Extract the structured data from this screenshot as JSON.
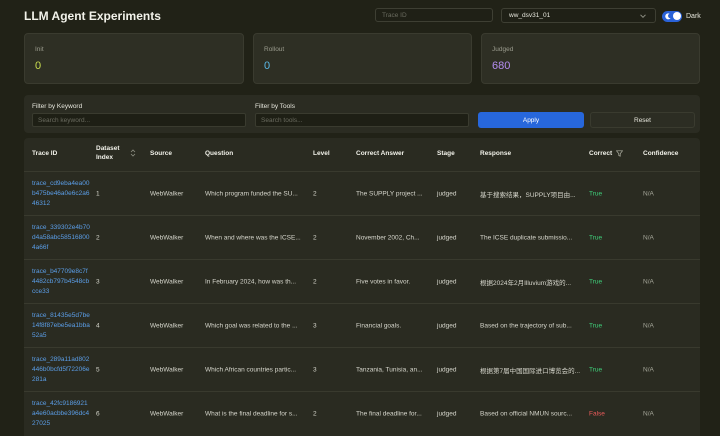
{
  "header": {
    "title": "LLM Agent Experiments",
    "trace_placeholder": "Trace ID",
    "dataset": "ww_dsv31_01",
    "theme_label": "Dark"
  },
  "stats": [
    {
      "label": "Init",
      "value": "0",
      "color": "#c9dd4f"
    },
    {
      "label": "Rollout",
      "value": "0",
      "color": "#5ab8e6"
    },
    {
      "label": "Judged",
      "value": "680",
      "color": "#b48cf0"
    }
  ],
  "filters": {
    "keyword_label": "Filter by Keyword",
    "keyword_placeholder": "Search keyword...",
    "tools_label": "Filter by Tools",
    "tools_placeholder": "Search tools...",
    "apply_label": "Apply",
    "reset_label": "Reset"
  },
  "table": {
    "headers": {
      "trace_id": "Trace ID",
      "dataset_index": "Dataset Index",
      "source": "Source",
      "question": "Question",
      "level": "Level",
      "correct_answer": "Correct Answer",
      "stage": "Stage",
      "response": "Response",
      "correct": "Correct",
      "confidence": "Confidence"
    },
    "rows": [
      {
        "trace": "trace_cd9eba4ea00b475be46a0e6c2a646312",
        "index": "1",
        "source": "WebWalker",
        "question": "Which program funded the SU...",
        "level": "2",
        "answer": "The SUPPLY project ...",
        "stage": "judged",
        "response": "基于搜索结果，SUPPLY项目由...",
        "correct": "True",
        "confidence": "N/A"
      },
      {
        "trace": "trace_339302e4b70d4a58abc585168004a66f",
        "index": "2",
        "source": "WebWalker",
        "question": "When and where was the ICSE...",
        "level": "2",
        "answer": "November 2002, Ch...",
        "stage": "judged",
        "response": "The ICSE duplicate submissio...",
        "correct": "True",
        "confidence": "N/A"
      },
      {
        "trace": "trace_b47709e8c7f4482cb797b4548cbcce33",
        "index": "3",
        "source": "WebWalker",
        "question": "In February 2024, how was th...",
        "level": "2",
        "answer": "Five votes in favor.",
        "stage": "judged",
        "response": "根据2024年2月Illuvium游戏的...",
        "correct": "True",
        "confidence": "N/A"
      },
      {
        "trace": "trace_81435e5d7be14f8f87ebe5ea1bba52a5",
        "index": "4",
        "source": "WebWalker",
        "question": "Which goal was related to the ...",
        "level": "3",
        "answer": "Financial goals.",
        "stage": "judged",
        "response": "Based on the trajectory of sub...",
        "correct": "True",
        "confidence": "N/A"
      },
      {
        "trace": "trace_289a11ad802446b0bcfd5f72206e281a",
        "index": "5",
        "source": "WebWalker",
        "question": "Which African countries partic...",
        "level": "3",
        "answer": "Tanzania, Tunisia, an...",
        "stage": "judged",
        "response": "根据第7届中国国际进口博览会的...",
        "correct": "True",
        "confidence": "N/A"
      },
      {
        "trace": "trace_42fc9186921a4e60acbbe396dc427025",
        "index": "6",
        "source": "WebWalker",
        "question": "What is the final deadline for s...",
        "level": "2",
        "answer": "The final deadline for...",
        "stage": "judged",
        "response": "Based on official NMUN sourc...",
        "correct": "False",
        "confidence": "N/A"
      }
    ]
  }
}
